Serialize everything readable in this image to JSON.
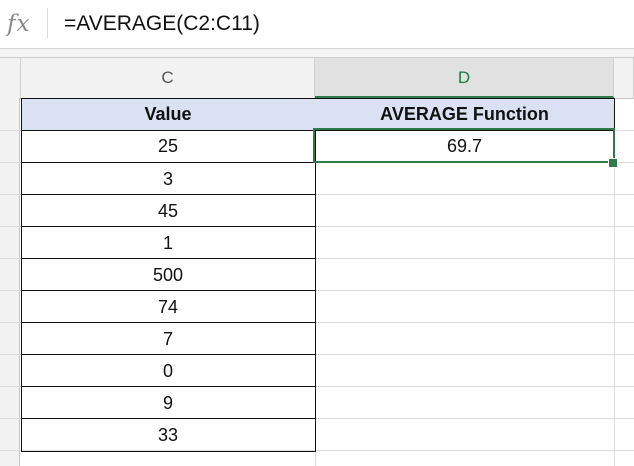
{
  "formula_bar": {
    "fx_label": "fx",
    "formula": "=AVERAGE(C2:C11)"
  },
  "columns": {
    "c": "C",
    "d": "D"
  },
  "table": {
    "header_value": "Value",
    "header_function": "AVERAGE Function",
    "values": [
      "25",
      "3",
      "45",
      "1",
      "500",
      "74",
      "7",
      "0",
      "9",
      "33"
    ],
    "result": "69.7"
  },
  "colors": {
    "header_fill": "#d9e1f2",
    "selection": "#2f7a4a"
  }
}
